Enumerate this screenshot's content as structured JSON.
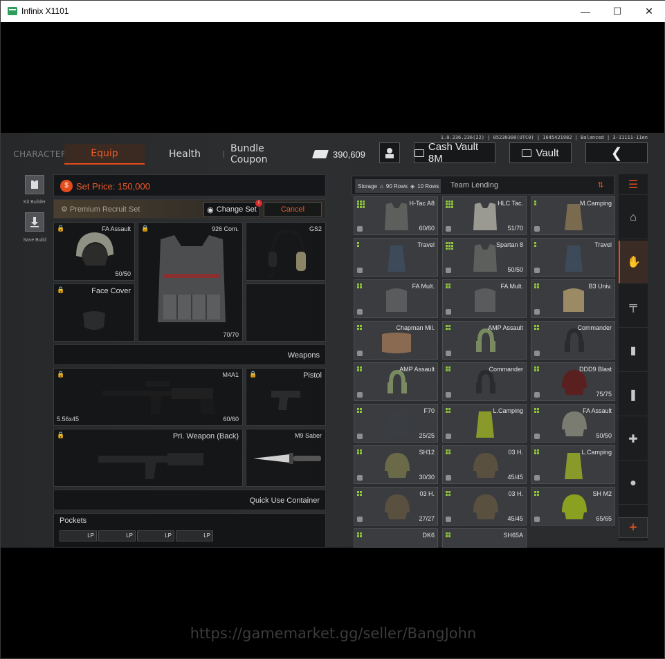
{
  "window": {
    "title": "Infinix X1101",
    "minimize": "—",
    "maximize": "☐",
    "close": "✕"
  },
  "build_info": "1.0.236.236(22) | 05230300(UTC0) | 1645421982 | Balanced | 3-11111-11en",
  "nav": {
    "character": "CHARACTER",
    "equip": "Equip",
    "health": "Health",
    "bundle_coupon": "Bundle Coupon",
    "currency_value": "390,609",
    "cash_vault": "Cash Vault 8M",
    "vault": "Vault",
    "back": "❮"
  },
  "left_rail": {
    "kit_builder": "Kit Builder",
    "save_build": "Save Build"
  },
  "loadout": {
    "set_price": "Set Price: 150,000",
    "recruit_set": "Premium Recruit Set",
    "change_set": "Change Set",
    "change_set_badge": "!",
    "cancel": "Cancel",
    "slots": {
      "helmet": {
        "name": "FA Assault",
        "durability": "50/50"
      },
      "armor": {
        "name": "926 Com.",
        "durability": "70/70"
      },
      "headset": {
        "name": "GS2"
      },
      "face_cover": {
        "name": "Face Cover"
      },
      "weapons_header": "Weapons",
      "primary": {
        "name": "M4A1",
        "ammo": "5.56x45",
        "durability": "60/60"
      },
      "pistol": {
        "name": "Pistol"
      },
      "primary_back": {
        "name": "Pri. Weapon (Back)"
      },
      "melee": {
        "name": "M9 Saber"
      },
      "quick_use": "Quick Use Container",
      "pockets": "Pockets",
      "pocket_labels": [
        "LP",
        "LP",
        "LP",
        "LP"
      ]
    }
  },
  "storage": {
    "label": "Storage",
    "rows_total": "90 Rows",
    "rows_used": "10 Rows",
    "team_lending": "Team Lending",
    "items": [
      {
        "name": "H-Tac A8",
        "dur": "60/60",
        "dots": 3,
        "art": "vest-gray"
      },
      {
        "name": "HLC Tac.",
        "dur": "51/70",
        "dots": 3,
        "art": "vest-light"
      },
      {
        "name": "M.Camping",
        "dur": "",
        "dots": 1,
        "art": "pack-tan"
      },
      {
        "name": "Travel",
        "dur": "",
        "dots": 1,
        "art": "pack-blue"
      },
      {
        "name": "Spartan 8",
        "dur": "50/50",
        "dots": 3,
        "art": "vest-gray"
      },
      {
        "name": "Travel",
        "dur": "",
        "dots": 1,
        "art": "pack-blue"
      },
      {
        "name": "FA Mult.",
        "dur": "",
        "dots": 2,
        "art": "pouch-gray"
      },
      {
        "name": "FA Mult.",
        "dur": "",
        "dots": 2,
        "art": "pouch-gray"
      },
      {
        "name": "B3 Univ.",
        "dur": "",
        "dots": 2,
        "art": "pouch-tan"
      },
      {
        "name": "Chapman Mil.",
        "dur": "",
        "dots": 2,
        "art": "duffel"
      },
      {
        "name": "AMP Assault",
        "dur": "",
        "dots": 2,
        "art": "headset-olive"
      },
      {
        "name": "Commander",
        "dur": "",
        "dots": 2,
        "art": "headset-dark"
      },
      {
        "name": "AMP Assault",
        "dur": "",
        "dots": 2,
        "art": "headset-olive"
      },
      {
        "name": "Commander",
        "dur": "",
        "dots": 2,
        "art": "headset-dark"
      },
      {
        "name": "DDD9 Blast",
        "dur": "75/75",
        "dots": 2,
        "art": "helmet-red"
      },
      {
        "name": "F70",
        "dur": "25/25",
        "dots": 2,
        "art": "helmet-dark"
      },
      {
        "name": "L.Camping",
        "dur": "",
        "dots": 2,
        "art": "pack-green"
      },
      {
        "name": "FA Assault",
        "dur": "50/50",
        "dots": 2,
        "art": "helmet-gray"
      },
      {
        "name": "SH12",
        "dur": "30/30",
        "dots": 2,
        "art": "helmet-olive"
      },
      {
        "name": "03 H.",
        "dur": "45/45",
        "dots": 2,
        "art": "helmet-camo"
      },
      {
        "name": "L.Camping",
        "dur": "",
        "dots": 2,
        "art": "pack-green"
      },
      {
        "name": "03 H.",
        "dur": "27/27",
        "dots": 2,
        "art": "helmet-camo"
      },
      {
        "name": "03 H.",
        "dur": "45/45",
        "dots": 2,
        "art": "helmet-camo"
      },
      {
        "name": "SH M2",
        "dur": "65/65",
        "dots": 2,
        "art": "helmet-green"
      },
      {
        "name": "DK6",
        "dur": "",
        "dots": 2,
        "art": "none"
      },
      {
        "name": "SH65A",
        "dur": "",
        "dots": 2,
        "art": "none"
      }
    ]
  },
  "categories": [
    "home-icon",
    "armor-icon",
    "rifle-icon",
    "magazine-icon",
    "ammo-icon",
    "medkit-icon",
    "grenade-icon"
  ],
  "add_label": "+",
  "watermark": "https://gamemarket.gg/seller/BangJohn",
  "colors": {
    "accent": "#e44c1c",
    "green_dot": "#8ec53a"
  }
}
